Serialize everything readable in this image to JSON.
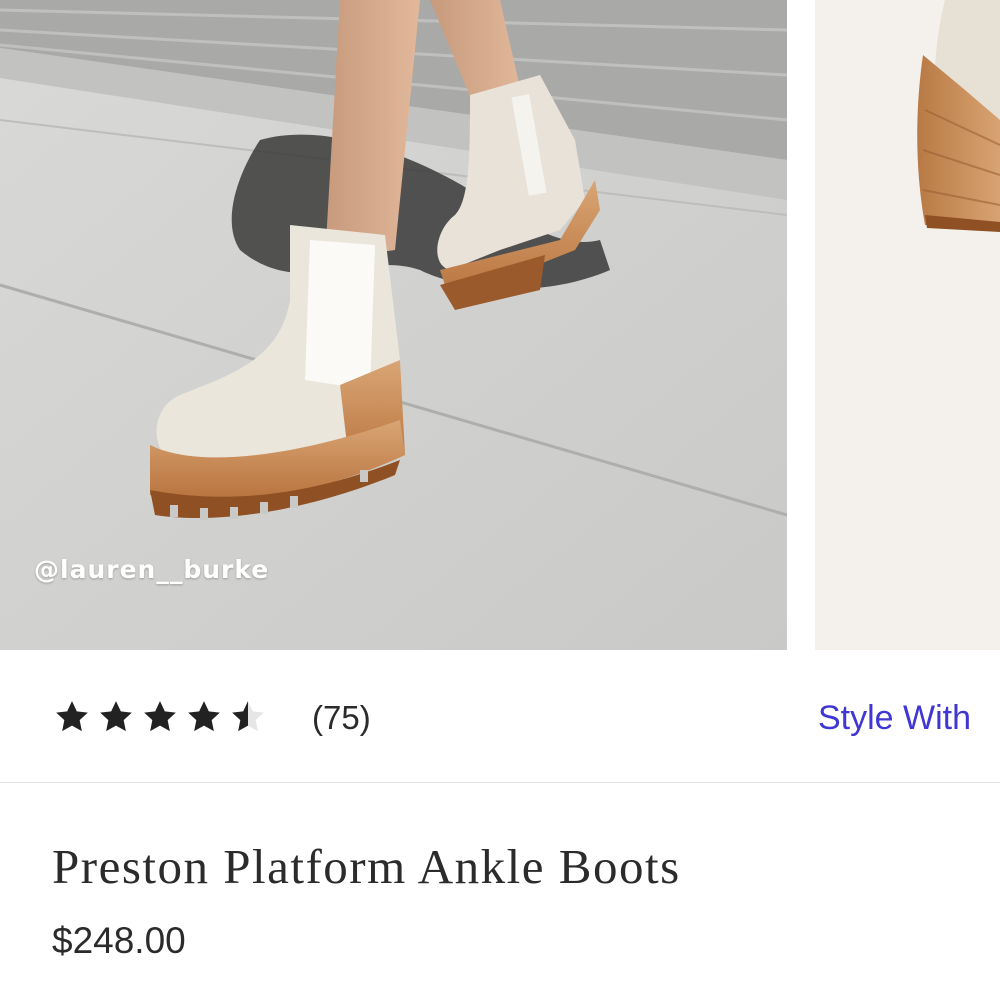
{
  "gallery": {
    "watermark": "@lauren__burke",
    "slides": [
      "lifestyle-photo-boots",
      "product-photo-boot-side"
    ]
  },
  "rating": {
    "stars": 4.5,
    "max_stars": 5,
    "review_count": "(75)",
    "star_color": "#222222"
  },
  "links": {
    "style_with": "Style With"
  },
  "product": {
    "title": "Preston Platform Ankle Boots",
    "price": "$248.00"
  },
  "colors": {
    "link": "#3f36d3",
    "text": "#2b2b2b"
  }
}
